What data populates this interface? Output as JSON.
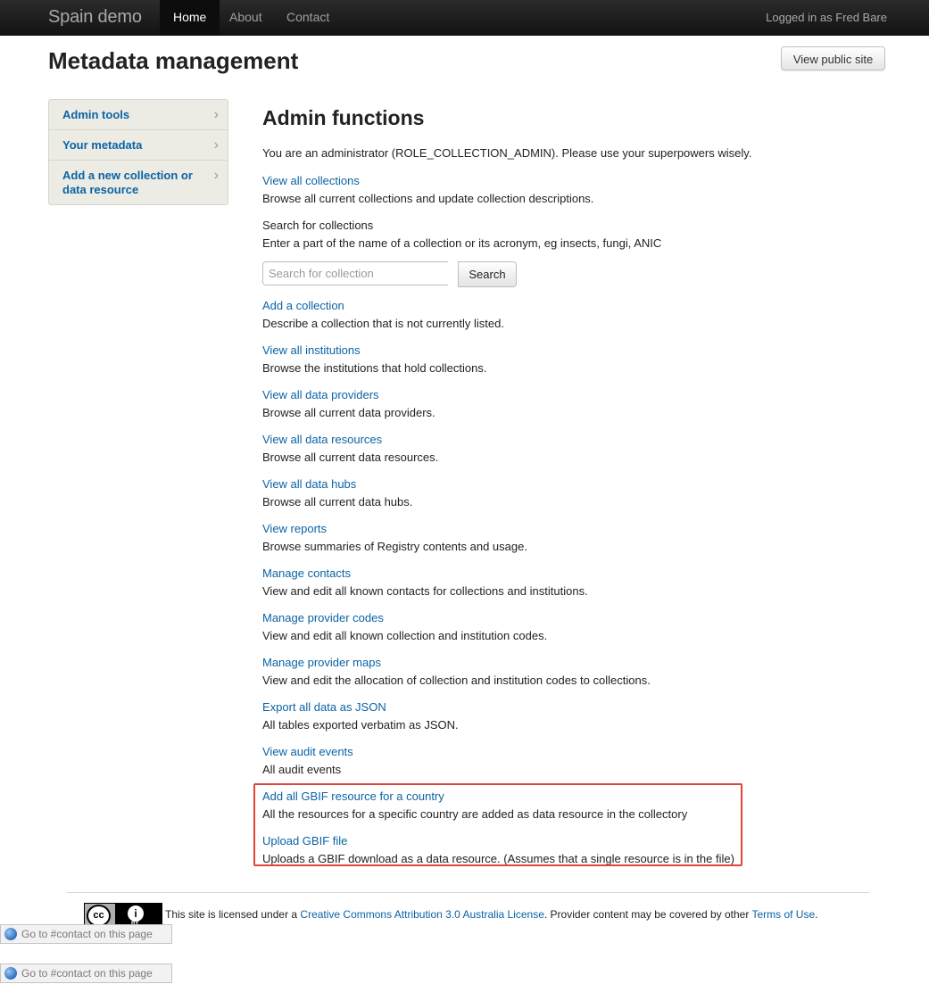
{
  "navbar": {
    "brand": "Spain demo",
    "items": [
      {
        "label": "Home",
        "active": true
      },
      {
        "label": "About",
        "active": false
      },
      {
        "label": "Contact",
        "active": false
      }
    ],
    "logged_in": "Logged in as Fred Bare"
  },
  "header": {
    "title": "Metadata management",
    "view_public_label": "View public site"
  },
  "sidebar": {
    "items": [
      {
        "label": "Admin tools"
      },
      {
        "label": "Your metadata"
      },
      {
        "label": "Add a new collection or data resource"
      }
    ]
  },
  "main": {
    "title": "Admin functions",
    "intro": "You are an administrator (ROLE_COLLECTION_ADMIN). Please use your superpowers wisely.",
    "view_collections": {
      "link": "View all collections",
      "desc": "Browse all current collections and update collection descriptions."
    },
    "search": {
      "heading": "Search for collections",
      "desc": "Enter a part of the name of a collection or its acronym, eg insects, fungi, ANIC",
      "placeholder": "Search for collection",
      "button": "Search"
    },
    "functions": [
      {
        "link": "Add a collection",
        "desc": "Describe a collection that is not currently listed."
      },
      {
        "link": "View all institutions",
        "desc": "Browse the institutions that hold collections."
      },
      {
        "link": "View all data providers",
        "desc": "Browse all current data providers."
      },
      {
        "link": "View all data resources",
        "desc": "Browse all current data resources."
      },
      {
        "link": "View all data hubs",
        "desc": "Browse all current data hubs."
      },
      {
        "link": "View reports",
        "desc": "Browse summaries of Registry contents and usage."
      },
      {
        "link": "Manage contacts",
        "desc": "View and edit all known contacts for collections and institutions."
      },
      {
        "link": "Manage provider codes",
        "desc": "View and edit all known collection and institution codes."
      },
      {
        "link": "Manage provider maps",
        "desc": "View and edit the allocation of collection and institution codes to collections."
      },
      {
        "link": "Export all data as JSON",
        "desc": "All tables exported verbatim as JSON."
      },
      {
        "link": "View audit events",
        "desc": "All audit events"
      },
      {
        "link": "Add all GBIF resource for a country",
        "desc": "All the resources for a specific country are added as data resource in the collectory"
      },
      {
        "link": "Upload GBIF file",
        "desc": "Uploads a GBIF download as a data resource. (Assumes that a single resource is in the file)"
      }
    ]
  },
  "footer": {
    "license_prefix": "This site is licensed under a ",
    "license_link": "Creative Commons Attribution 3.0 Australia License",
    "license_middle": ". Provider content may be covered by other ",
    "terms_link": "Terms of Use",
    "license_suffix": ".",
    "badge_cc": "cc",
    "badge_by": "BY",
    "goto_label": "Go to #contact on this page"
  },
  "colors": {
    "link": "#0b63a5",
    "navbar": "#1b1b1b",
    "sidebar_bg": "#ecece4",
    "highlight": "#e0453a"
  },
  "icons": {
    "chevron": "chevron-right-icon",
    "cc": "creative-commons-icon",
    "by": "attribution-icon",
    "globe": "globe-icon"
  }
}
